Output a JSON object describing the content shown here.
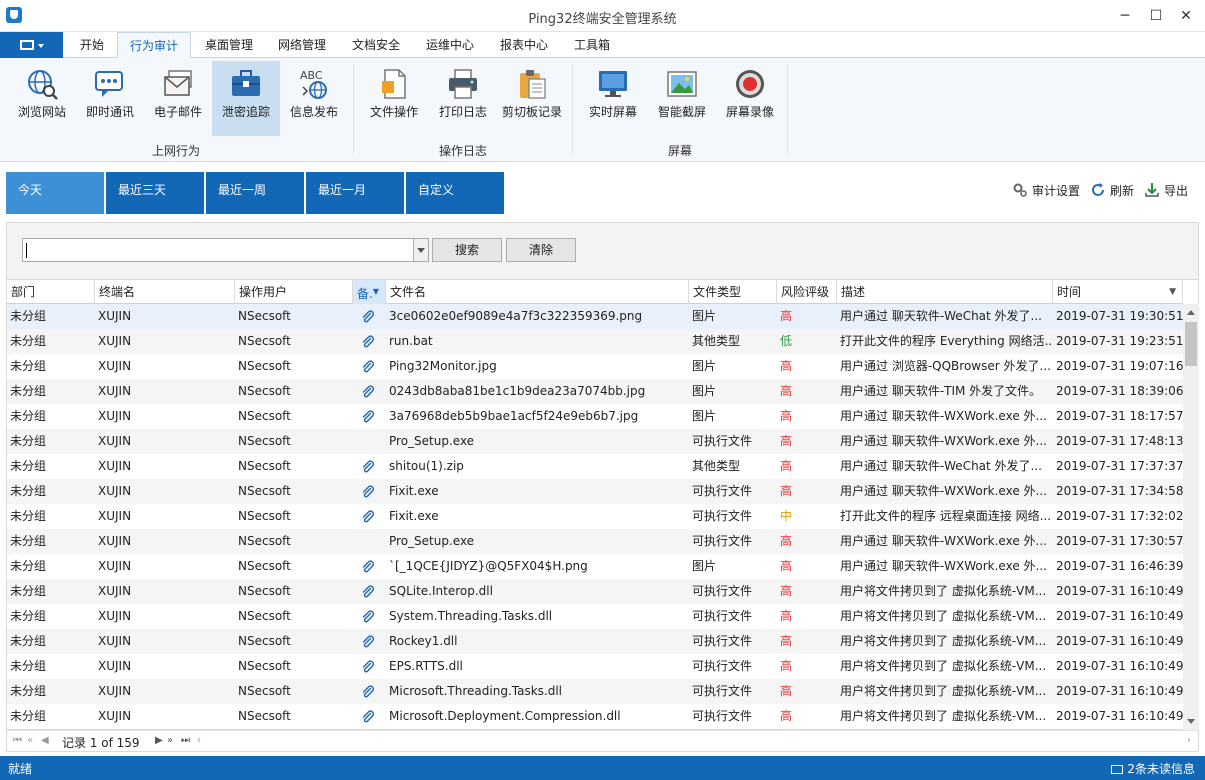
{
  "window": {
    "title": "Ping32终端安全管理系统",
    "minimize": "─",
    "maximize": "☐",
    "close": "✕"
  },
  "menu": {
    "tabs": [
      {
        "label": "开始"
      },
      {
        "label": "行为审计"
      },
      {
        "label": "桌面管理"
      },
      {
        "label": "网络管理"
      },
      {
        "label": "文档安全"
      },
      {
        "label": "运维中心"
      },
      {
        "label": "报表中心"
      },
      {
        "label": "工具箱"
      }
    ],
    "active_index": 1
  },
  "ribbon": {
    "buttons": [
      {
        "label": "浏览网站",
        "icon": "globe-search-icon"
      },
      {
        "label": "即时通讯",
        "icon": "chat-bubble-icon"
      },
      {
        "label": "电子邮件",
        "icon": "email-icon"
      },
      {
        "label": "泄密追踪",
        "icon": "briefcase-icon"
      },
      {
        "label": "信息发布",
        "icon": "abc-globe-icon"
      },
      {
        "label": "文件操作",
        "icon": "file-icon"
      },
      {
        "label": "打印日志",
        "icon": "printer-icon"
      },
      {
        "label": "剪切板记录",
        "icon": "clipboard-icon"
      },
      {
        "label": "实时屏幕",
        "icon": "monitor-icon"
      },
      {
        "label": "智能截屏",
        "icon": "picture-icon"
      },
      {
        "label": "屏幕录像",
        "icon": "record-icon"
      }
    ],
    "active_index": 3,
    "groups": [
      {
        "label": "上网行为"
      },
      {
        "label": "操作日志"
      },
      {
        "label": "屏幕"
      }
    ]
  },
  "date_tabs": {
    "items": [
      {
        "label": "今天"
      },
      {
        "label": "最近三天"
      },
      {
        "label": "最近一周"
      },
      {
        "label": "最近一月"
      },
      {
        "label": "自定义"
      }
    ],
    "active_index": 0
  },
  "toolbar": {
    "audit_settings": "审计设置",
    "refresh": "刷新",
    "export": "导出"
  },
  "search": {
    "value": "",
    "search_label": "搜索",
    "clear_label": "清除"
  },
  "table": {
    "columns": [
      "部门",
      "终端名",
      "操作用户",
      "备.",
      "文件名",
      "文件类型",
      "风险评级",
      "描述",
      "时间"
    ],
    "rows": [
      {
        "dept": "未分组",
        "terminal": "XUJIN",
        "user": "NSecsoft",
        "attach": true,
        "file": "3ce0602e0ef9089e4a7f3c322359369.png",
        "type": "图片",
        "risk": "高",
        "desc": "用户通过 聊天软件-WeChat 外发了...",
        "time": "2019-07-31 19:30:51"
      },
      {
        "dept": "未分组",
        "terminal": "XUJIN",
        "user": "NSecsoft",
        "attach": true,
        "file": "run.bat",
        "type": "其他类型",
        "risk": "低",
        "desc": "打开此文件的程序 Everything 网络活...",
        "time": "2019-07-31 19:23:51"
      },
      {
        "dept": "未分组",
        "terminal": "XUJIN",
        "user": "NSecsoft",
        "attach": true,
        "file": "Ping32Monitor.jpg",
        "type": "图片",
        "risk": "高",
        "desc": "用户通过 浏览器-QQBrowser 外发了...",
        "time": "2019-07-31 19:07:16"
      },
      {
        "dept": "未分组",
        "terminal": "XUJIN",
        "user": "NSecsoft",
        "attach": true,
        "file": "0243db8aba81be1c1b9dea23a7074bb.jpg",
        "type": "图片",
        "risk": "高",
        "desc": "用户通过 聊天软件-TIM 外发了文件。",
        "time": "2019-07-31 18:39:06"
      },
      {
        "dept": "未分组",
        "terminal": "XUJIN",
        "user": "NSecsoft",
        "attach": true,
        "file": "3a76968deb5b9bae1acf5f24e9eb6b7.jpg",
        "type": "图片",
        "risk": "高",
        "desc": "用户通过 聊天软件-WXWork.exe 外...",
        "time": "2019-07-31 18:17:57"
      },
      {
        "dept": "未分组",
        "terminal": "XUJIN",
        "user": "NSecsoft",
        "attach": false,
        "file": "Pro_Setup.exe",
        "type": "可执行文件",
        "risk": "高",
        "desc": "用户通过 聊天软件-WXWork.exe 外...",
        "time": "2019-07-31 17:48:13"
      },
      {
        "dept": "未分组",
        "terminal": "XUJIN",
        "user": "NSecsoft",
        "attach": true,
        "file": "shitou(1).zip",
        "type": "其他类型",
        "risk": "高",
        "desc": "用户通过 聊天软件-WeChat 外发了...",
        "time": "2019-07-31 17:37:37"
      },
      {
        "dept": "未分组",
        "terminal": "XUJIN",
        "user": "NSecsoft",
        "attach": true,
        "file": "Fixit.exe",
        "type": "可执行文件",
        "risk": "高",
        "desc": "用户通过 聊天软件-WXWork.exe 外...",
        "time": "2019-07-31 17:34:58"
      },
      {
        "dept": "未分组",
        "terminal": "XUJIN",
        "user": "NSecsoft",
        "attach": true,
        "file": "Fixit.exe",
        "type": "可执行文件",
        "risk": "中",
        "desc": "打开此文件的程序 远程桌面连接 网络...",
        "time": "2019-07-31 17:32:02"
      },
      {
        "dept": "未分组",
        "terminal": "XUJIN",
        "user": "NSecsoft",
        "attach": false,
        "file": "Pro_Setup.exe",
        "type": "可执行文件",
        "risk": "高",
        "desc": "用户通过 聊天软件-WXWork.exe 外...",
        "time": "2019-07-31 17:30:57"
      },
      {
        "dept": "未分组",
        "terminal": "XUJIN",
        "user": "NSecsoft",
        "attach": true,
        "file": "`[_1QCE{JIDYZ}@Q5FX04$H.png",
        "type": "图片",
        "risk": "高",
        "desc": "用户通过 聊天软件-WXWork.exe 外...",
        "time": "2019-07-31 16:46:39"
      },
      {
        "dept": "未分组",
        "terminal": "XUJIN",
        "user": "NSecsoft",
        "attach": true,
        "file": "SQLite.Interop.dll",
        "type": "可执行文件",
        "risk": "高",
        "desc": "用户将文件拷贝到了 虚拟化系统-VM...",
        "time": "2019-07-31 16:10:49"
      },
      {
        "dept": "未分组",
        "terminal": "XUJIN",
        "user": "NSecsoft",
        "attach": true,
        "file": "System.Threading.Tasks.dll",
        "type": "可执行文件",
        "risk": "高",
        "desc": "用户将文件拷贝到了 虚拟化系统-VM...",
        "time": "2019-07-31 16:10:49"
      },
      {
        "dept": "未分组",
        "terminal": "XUJIN",
        "user": "NSecsoft",
        "attach": true,
        "file": "Rockey1.dll",
        "type": "可执行文件",
        "risk": "高",
        "desc": "用户将文件拷贝到了 虚拟化系统-VM...",
        "time": "2019-07-31 16:10:49"
      },
      {
        "dept": "未分组",
        "terminal": "XUJIN",
        "user": "NSecsoft",
        "attach": true,
        "file": "EPS.RTTS.dll",
        "type": "可执行文件",
        "risk": "高",
        "desc": "用户将文件拷贝到了 虚拟化系统-VM...",
        "time": "2019-07-31 16:10:49"
      },
      {
        "dept": "未分组",
        "terminal": "XUJIN",
        "user": "NSecsoft",
        "attach": true,
        "file": "Microsoft.Threading.Tasks.dll",
        "type": "可执行文件",
        "risk": "高",
        "desc": "用户将文件拷贝到了 虚拟化系统-VM...",
        "time": "2019-07-31 16:10:49"
      },
      {
        "dept": "未分组",
        "terminal": "XUJIN",
        "user": "NSecsoft",
        "attach": true,
        "file": "Microsoft.Deployment.Compression.dll",
        "type": "可执行文件",
        "risk": "高",
        "desc": "用户将文件拷贝到了 虚拟化系统-VM...",
        "time": "2019-07-31 16:10:49"
      }
    ],
    "selected_index": 0
  },
  "pager": {
    "text": "记录 1 of 159"
  },
  "status": {
    "left": "就绪",
    "right": "2条未读信息"
  },
  "colors": {
    "primary": "#1367b7",
    "risk_high": "#e03030",
    "risk_low": "#2aa040",
    "risk_mid": "#e09a10"
  }
}
